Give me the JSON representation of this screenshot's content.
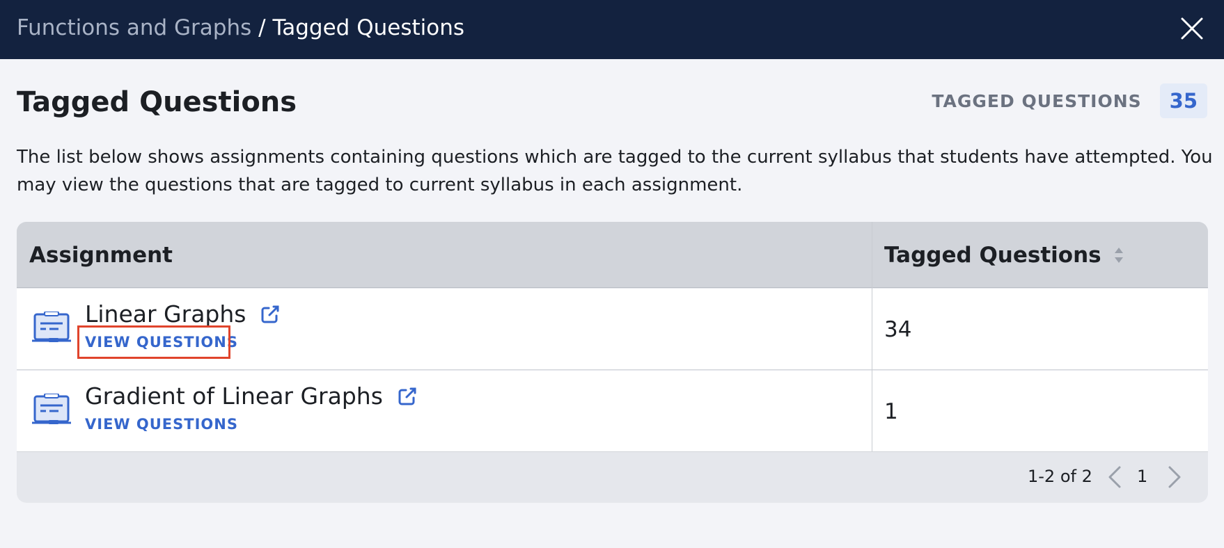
{
  "header": {
    "breadcrumb_parent": "Functions and Graphs",
    "breadcrumb_separator": "/",
    "breadcrumb_current": "Tagged Questions",
    "close_icon": "close-icon"
  },
  "page": {
    "title": "Tagged Questions",
    "counter_label": "TAGGED QUESTIONS",
    "counter_value": "35",
    "description": "The list below shows assignments containing questions which are tagged to the current syllabus that students have attempted. You may view the questions that are tagged to current syllabus in each assignment."
  },
  "table": {
    "headers": {
      "assignment": "Assignment",
      "tagged": "Tagged Questions"
    },
    "rows": [
      {
        "name": "Linear Graphs",
        "action": "VIEW QUESTIONS",
        "tagged": "34"
      },
      {
        "name": "Gradient of Linear Graphs",
        "action": "VIEW QUESTIONS",
        "tagged": "1"
      }
    ]
  },
  "pagination": {
    "range": "1-2 of 2",
    "page": "1"
  },
  "colors": {
    "header_bg": "#13223f",
    "accent": "#3566cc",
    "highlight": "#e0442c"
  }
}
